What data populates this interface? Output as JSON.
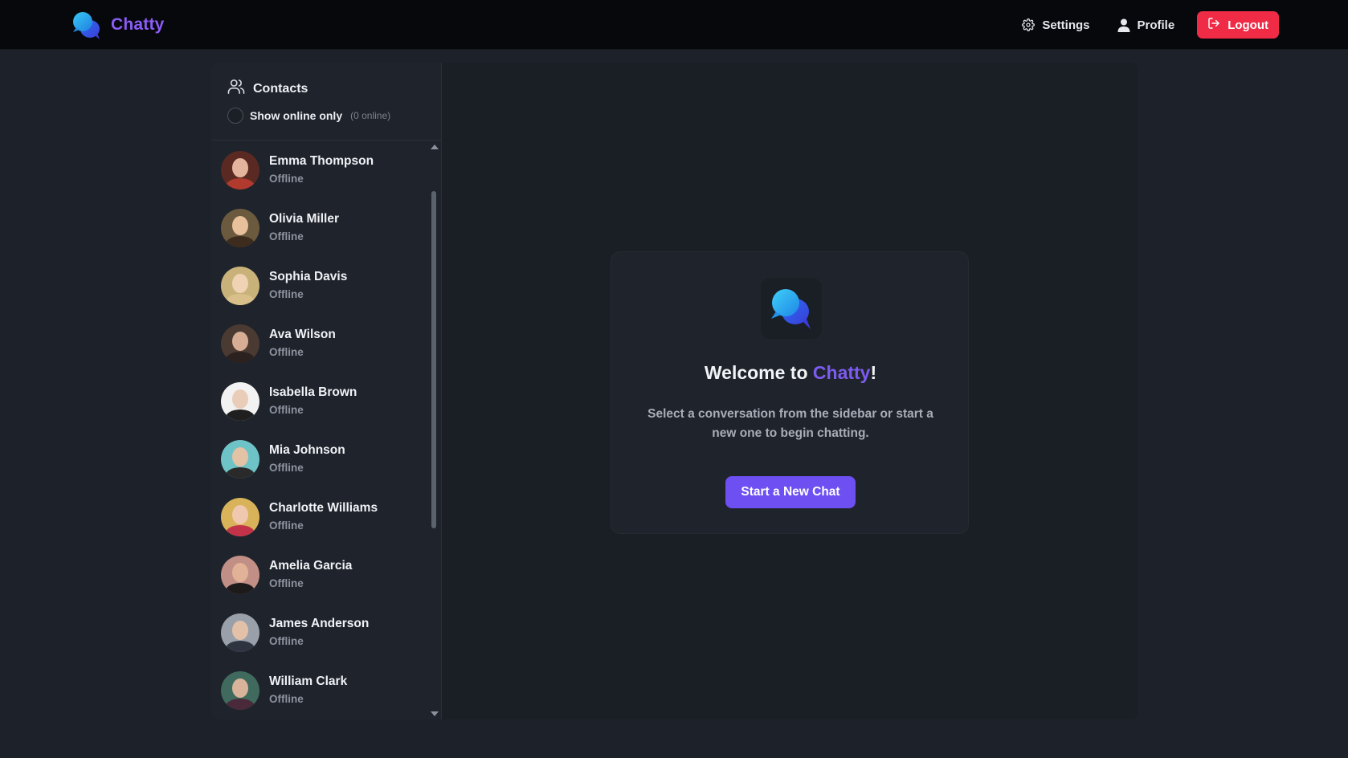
{
  "app": {
    "name": "Chatty"
  },
  "nav": {
    "settings_label": "Settings",
    "profile_label": "Profile",
    "logout_label": "Logout"
  },
  "sidebar": {
    "title": "Contacts",
    "toggle_label": "Show online only",
    "online_count": "(0 online)",
    "contacts": [
      {
        "name": "Emma Thompson",
        "status": "Offline"
      },
      {
        "name": "Olivia Miller",
        "status": "Offline"
      },
      {
        "name": "Sophia Davis",
        "status": "Offline"
      },
      {
        "name": "Ava Wilson",
        "status": "Offline"
      },
      {
        "name": "Isabella Brown",
        "status": "Offline"
      },
      {
        "name": "Mia Johnson",
        "status": "Offline"
      },
      {
        "name": "Charlotte Williams",
        "status": "Offline"
      },
      {
        "name": "Amelia Garcia",
        "status": "Offline"
      },
      {
        "name": "James Anderson",
        "status": "Offline"
      },
      {
        "name": "William Clark",
        "status": "Offline"
      }
    ]
  },
  "welcome": {
    "title_prefix": "Welcome to ",
    "title_brand": "Chatty",
    "title_suffix": "!",
    "description": "Select a conversation from the sidebar or start a new one to begin chatting.",
    "button_label": "Start a New Chat"
  },
  "colors": {
    "accent": "#7c5cf0",
    "logout": "#ef2b46",
    "background": "#1d2129",
    "navbar": "#06080c"
  },
  "icons": {
    "brand": "chat-bubbles-icon",
    "settings": "gear-icon",
    "profile": "user-icon",
    "logout": "logout-icon",
    "contacts": "users-icon"
  }
}
